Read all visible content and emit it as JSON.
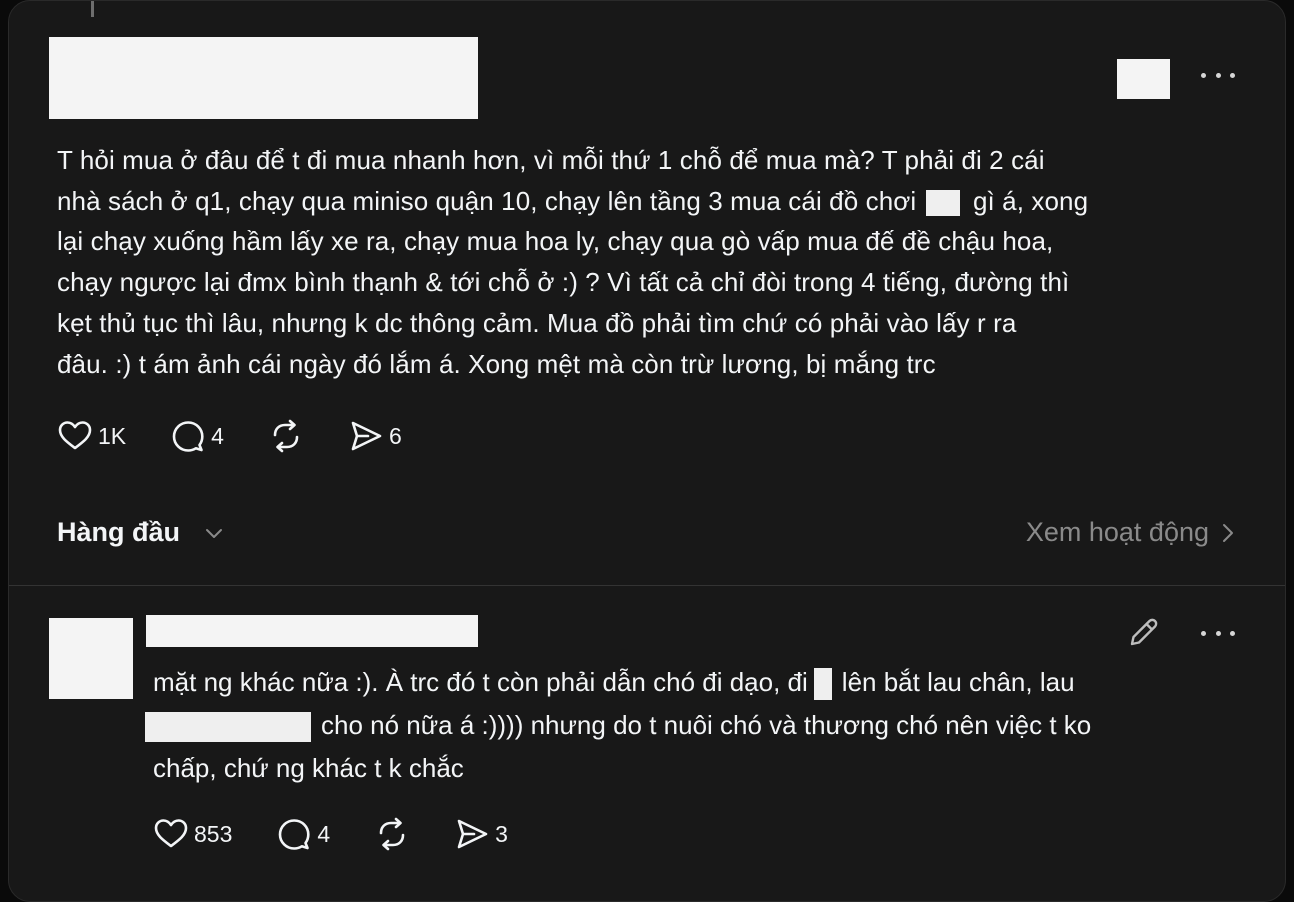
{
  "post": {
    "text_lines": [
      "T hỏi mua ở đâu để t đi mua nhanh hơn, vì mỗi thứ 1 chỗ để mua mà? T phải đi 2 cái",
      "nhà sách ở q1, chạy qua miniso quận 10, chạy lên tầng 3 mua cái đồ chơi",
      "gì á, xong",
      "lại chạy xuống hầm lấy xe ra, chạy mua hoa ly, chạy qua gò vấp mua đế đề chậu hoa,",
      "chạy ngược lại đmx bình thạnh & tới chỗ ở :) ? Vì tất cả chỉ đòi trong 4 tiếng, đường thì",
      "kẹt thủ tục thì lâu, nhưng k dc thông cảm. Mua đồ phải tìm chứ có phải vào lấy r ra",
      "đâu. :) t ám ảnh cái ngày đó lắm á. Xong mệt mà còn trừ lương, bị mắng trc"
    ],
    "likes": "1K",
    "replies": "4",
    "reposts": "",
    "shares": "6"
  },
  "sort": {
    "label": "Hàng đầu",
    "activity_link": "Xem hoạt động"
  },
  "reply": {
    "line1_a": "mặt ng khác nữa :). À trc đó t còn phải dẫn chó đi dạo, đi",
    "line1_b": "lên bắt lau chân, lau",
    "line2": "cho nó nữa á :)))) nhưng do t nuôi chó và thương chó nên việc t ko",
    "line3": "chấp, chứ ng khác t k chắc",
    "likes": "853",
    "replies": "4",
    "reposts": "",
    "shares": "3"
  },
  "icons": {
    "like": "heart-icon",
    "reply": "comment-bubble-icon",
    "repost": "repost-icon",
    "share": "send-icon",
    "more": "more-horizontal-icon",
    "edit": "pencil-icon"
  },
  "colors": {
    "background": "#181818",
    "text": "#f3f5f7",
    "muted": "#8a8a8a",
    "divider": "#333333"
  }
}
